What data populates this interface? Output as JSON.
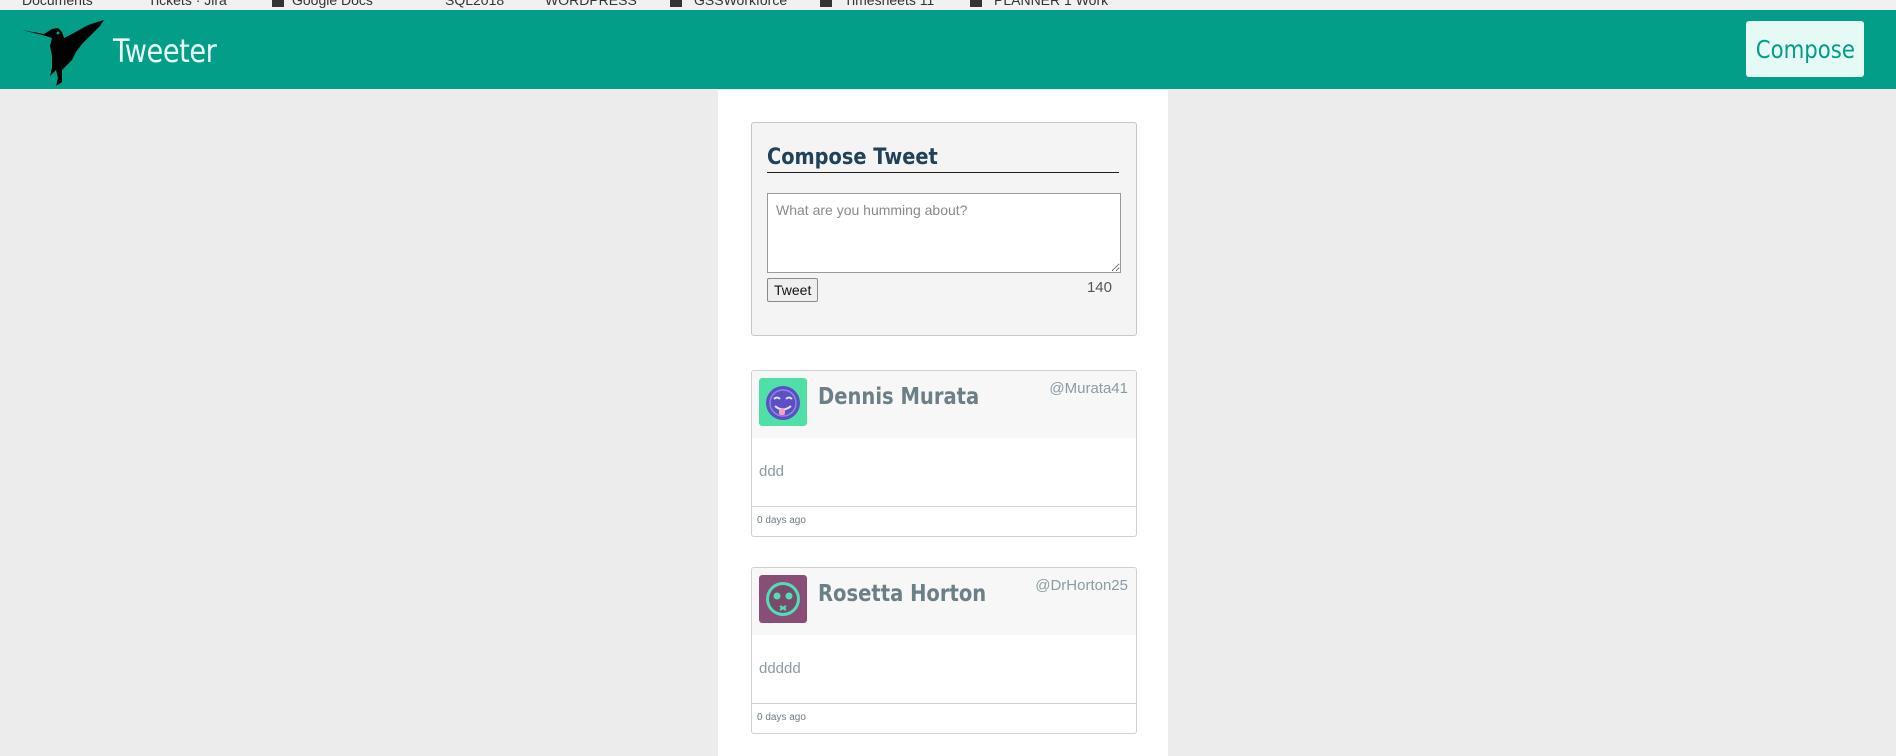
{
  "browser": {
    "bookmarks": [
      "Documents",
      "Tickets · Jira",
      "Google Docs",
      "SQL2018",
      "WORDPRESS",
      "GSSWorkforce",
      "Timesheets 11",
      "PLANNER 1 Work"
    ]
  },
  "header": {
    "brand": "Tweeter",
    "compose_button": "Compose"
  },
  "compose": {
    "title": "Compose Tweet",
    "placeholder": "What are you humming about?",
    "value": "",
    "tweet_button": "Tweet",
    "counter": "140"
  },
  "tweets": [
    {
      "name": "Dennis Murata",
      "handle": "@Murata41",
      "content": "ddd",
      "time": "0 days ago",
      "avatar_bg": "#4ee0a6",
      "avatar_fg": "#5b4fc6"
    },
    {
      "name": "Rosetta Horton",
      "handle": "@DrHorton25",
      "content": "ddddd",
      "time": "0 days ago",
      "avatar_bg": "#8a4e76",
      "avatar_fg": "#4ee0b5"
    }
  ],
  "colors": {
    "accent": "#029e87",
    "background": "#ececec"
  }
}
